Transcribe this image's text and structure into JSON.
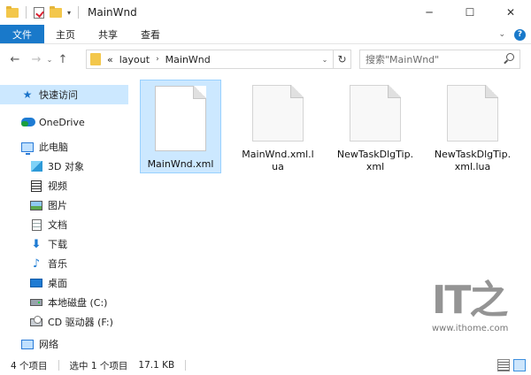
{
  "window": {
    "title": "MainWnd",
    "controls": {
      "minimize": "─",
      "maximize": "☐",
      "close": "✕"
    }
  },
  "ribbon": {
    "tabs": [
      "文件",
      "主页",
      "共享",
      "查看"
    ],
    "expand_glyph": "⌄",
    "help_glyph": "?"
  },
  "nav": {
    "back": "←",
    "forward": "→",
    "recent": "⌄",
    "up": "↑"
  },
  "address": {
    "overflow": "«",
    "crumbs": [
      "layout",
      "MainWnd"
    ],
    "separator": "›",
    "dropdown": "⌄",
    "refresh": "↻"
  },
  "search": {
    "placeholder": "搜索\"MainWnd\""
  },
  "sidebar": {
    "items": [
      {
        "label": "快速访问",
        "icon": "star-icon"
      },
      {
        "label": "OneDrive",
        "icon": "onedrive-icon"
      },
      {
        "label": "此电脑",
        "icon": "pc-icon"
      },
      {
        "label": "3D 对象",
        "icon": "3d-objects-icon"
      },
      {
        "label": "视频",
        "icon": "video-icon"
      },
      {
        "label": "图片",
        "icon": "pictures-icon"
      },
      {
        "label": "文档",
        "icon": "documents-icon"
      },
      {
        "label": "下载",
        "icon": "download-icon"
      },
      {
        "label": "音乐",
        "icon": "music-icon"
      },
      {
        "label": "桌面",
        "icon": "desktop-icon"
      },
      {
        "label": "本地磁盘 (C:)",
        "icon": "drive-icon"
      },
      {
        "label": "CD 驱动器 (F:)",
        "icon": "cd-drive-icon"
      },
      {
        "label": "网络",
        "icon": "network-icon"
      }
    ]
  },
  "files": [
    {
      "name": "MainWnd.xml",
      "selected": true
    },
    {
      "name": "MainWnd.xml.lua",
      "selected": false
    },
    {
      "name": "NewTaskDlgTip.xml",
      "selected": false
    },
    {
      "name": "NewTaskDlgTip.xml.lua",
      "selected": false
    }
  ],
  "status": {
    "count": "4 个项目",
    "selection": "选中 1 个项目",
    "size": "17.1 KB"
  },
  "watermark": {
    "logo": "IT之",
    "url": "www.ithome.com"
  },
  "colors": {
    "accent": "#1979ca",
    "selection": "#cce8ff",
    "selection_border": "#99d1ff"
  }
}
